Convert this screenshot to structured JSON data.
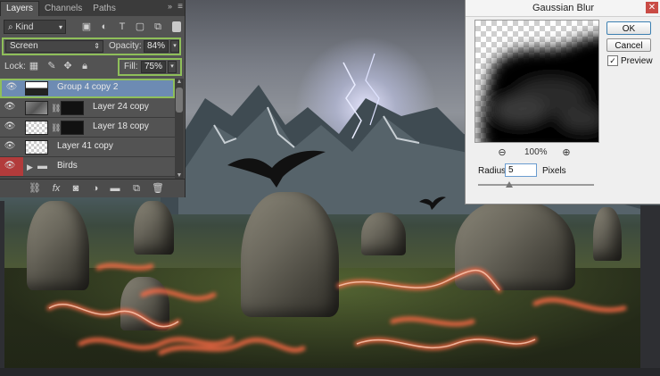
{
  "layers_panel": {
    "tabs": [
      {
        "label": "Layers",
        "active": true
      },
      {
        "label": "Channels",
        "active": false
      },
      {
        "label": "Paths",
        "active": false
      }
    ],
    "collapse_glyph": "»",
    "menu_glyph": "≡",
    "filter": {
      "kind_label": "Kind",
      "icons": [
        "image-filter-icon",
        "adjustment-filter-icon",
        "type-filter-icon",
        "shape-filter-icon",
        "smart-object-filter-icon"
      ]
    },
    "blend_mode": "Screen",
    "opacity_label": "Opacity:",
    "opacity_value": "84%",
    "lock_label": "Lock:",
    "fill_label": "Fill:",
    "fill_value": "75%",
    "layers": [
      {
        "name": "Group 4 copy 2",
        "selected": true,
        "visible": true
      },
      {
        "name": "Layer 24 copy",
        "selected": false,
        "visible": true
      },
      {
        "name": "Layer 18 copy",
        "selected": false,
        "visible": true
      },
      {
        "name": "Layer 41 copy",
        "selected": false,
        "visible": true
      },
      {
        "name": "Birds",
        "selected": false,
        "visible": true,
        "group": true
      }
    ],
    "footer_icons": [
      "link-icon",
      "fx-icon",
      "mask-icon",
      "adjustment-icon",
      "folder-icon",
      "new-layer-icon",
      "trash-icon"
    ]
  },
  "gaussian_blur": {
    "title": "Gaussian Blur",
    "ok_label": "OK",
    "cancel_label": "Cancel",
    "preview_label": "Preview",
    "preview_checked": true,
    "zoom_value": "100%",
    "radius_label": "Radius:",
    "radius_value": "5",
    "radius_unit": "Pixels",
    "slider_fraction": 0.27
  },
  "colors": {
    "highlight_green": "#8fbf5a",
    "selected_layer": "#6d8bb3",
    "fire_red": "#ff5a3c"
  }
}
